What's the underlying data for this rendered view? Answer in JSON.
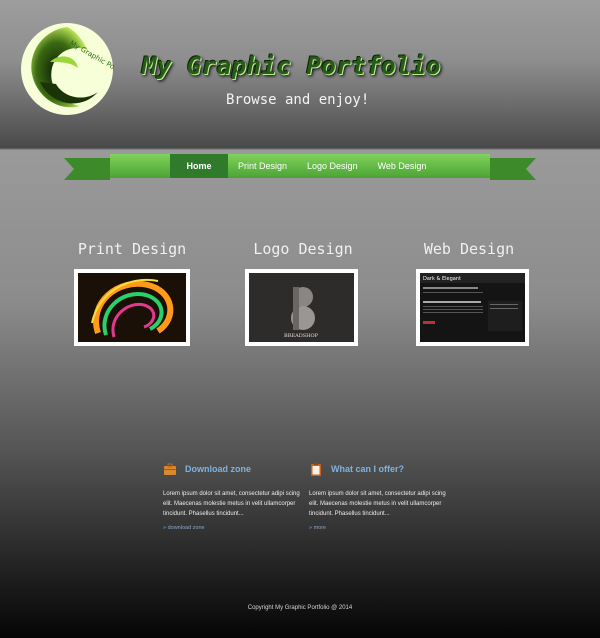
{
  "header": {
    "title": "My Graphic Portfolio",
    "tagline": "Browse and enjoy!",
    "logo_text": "My Graphic Portfolio",
    "logo_icon": "swirl-logo-icon"
  },
  "nav": {
    "items": [
      {
        "label": "Home",
        "active": true
      },
      {
        "label": "Print Design",
        "active": false
      },
      {
        "label": "Logo Design",
        "active": false
      },
      {
        "label": "Web Design",
        "active": false
      }
    ]
  },
  "portfolio": {
    "sections": [
      {
        "title": "Print Design"
      },
      {
        "title": "Logo Design",
        "thumb_text": "BREADSHOP"
      },
      {
        "title": "Web Design",
        "thumb_text": "Dark & Elegant"
      }
    ]
  },
  "info": {
    "download": {
      "title": "Download zone",
      "icon": "briefcase-icon",
      "text": "Lorem ipsum dolor sit amet, consectetur adipi scing elit. Maecenas molestie metus in velit ullamcorper tincidunt. Phasellus tincidunt...",
      "link": "» download zone"
    },
    "offer": {
      "title": "What can I offer?",
      "icon": "clipboard-icon",
      "text": "Lorem ipsum dolor sit amet, consectetur adipi scing elit. Maecenas molestie metus in velit ullamcorper tincidunt. Phasellus tincidunt...",
      "link": "» more"
    }
  },
  "footer": {
    "copyright": "Copyright My Graphic Portfolio @ 2014"
  },
  "colors": {
    "accent_green": "#4ca334",
    "nav_active": "#2f7a2b",
    "link_blue": "#7eb2de"
  }
}
